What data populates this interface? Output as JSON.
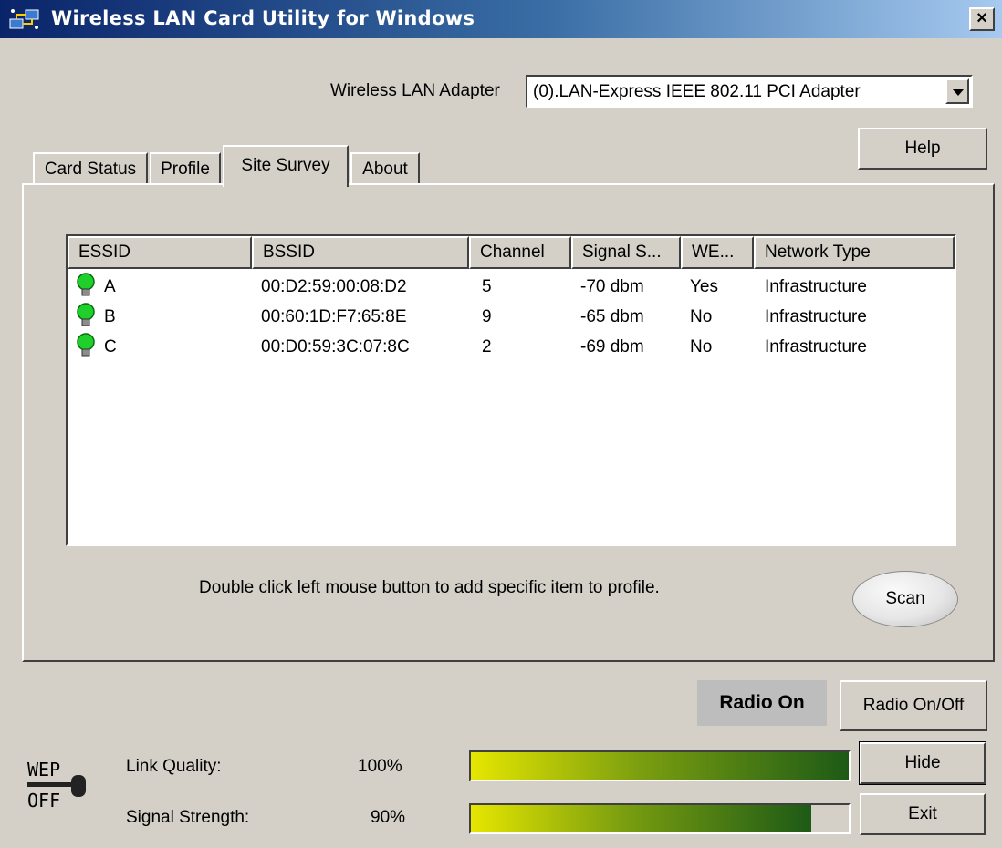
{
  "window": {
    "title": "Wireless LAN Card Utility for Windows",
    "close_glyph": "×"
  },
  "adapter": {
    "label": "Wireless LAN Adapter",
    "value": "(0).LAN-Express IEEE 802.11 PCI Adapter"
  },
  "tabs": [
    {
      "label": "Card Status"
    },
    {
      "label": "Profile"
    },
    {
      "label": "Site Survey",
      "active": true
    },
    {
      "label": "About"
    }
  ],
  "help_label": "Help",
  "survey": {
    "columns": [
      "ESSID",
      "BSSID",
      "Channel",
      "Signal S...",
      "WE...",
      "Network Type"
    ],
    "rows": [
      {
        "essid": "A",
        "bssid": "00:D2:59:00:08:D2",
        "channel": "5",
        "signal": "-70 dbm",
        "wep": "Yes",
        "type": "Infrastructure"
      },
      {
        "essid": "B",
        "bssid": "00:60:1D:F7:65:8E",
        "channel": "9",
        "signal": "-65 dbm",
        "wep": "No",
        "type": "Infrastructure"
      },
      {
        "essid": "C",
        "bssid": "00:D0:59:3C:07:8C",
        "channel": "2",
        "signal": "-69 dbm",
        "wep": "No",
        "type": "Infrastructure"
      }
    ],
    "hint": "Double click left mouse button to add specific item to profile.",
    "scan_label": "Scan",
    "row_icon": "green-bulb-icon"
  },
  "radio": {
    "status": "Radio On",
    "toggle_label": "Radio On/Off"
  },
  "link_quality": {
    "label": "Link Quality:",
    "value": "100%",
    "fraction": 1.0
  },
  "signal_strength": {
    "label": "Signal Strength:",
    "value": "90%",
    "fraction": 0.9
  },
  "wep_indicator": {
    "line1": "WEP",
    "line2": "OFF"
  },
  "hide_label": "Hide",
  "exit_label": "Exit",
  "colors": {
    "titlebar_start": "#0a246a",
    "titlebar_end": "#a6caf0",
    "face": "#d4d0c8",
    "bar_start": "#e6e600",
    "bar_end": "#1d5a16"
  }
}
